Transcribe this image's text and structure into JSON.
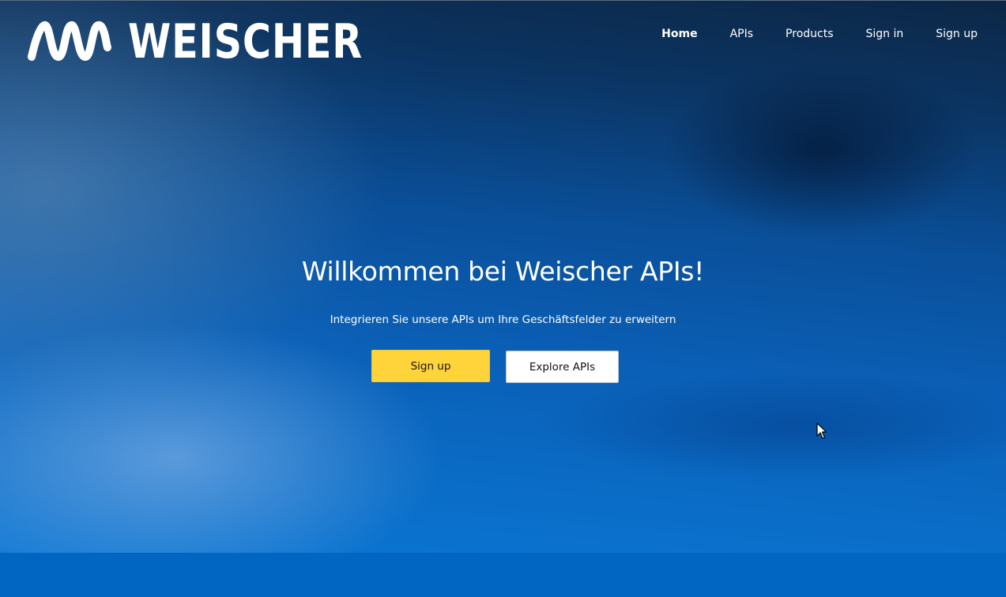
{
  "brand": {
    "name": "WEISCHER"
  },
  "nav": {
    "items": [
      {
        "label": "Home",
        "active": true
      },
      {
        "label": "APIs",
        "active": false
      },
      {
        "label": "Products",
        "active": false
      },
      {
        "label": "Sign in",
        "active": false
      },
      {
        "label": "Sign up",
        "active": false
      }
    ]
  },
  "hero": {
    "title": "Willkommen bei Weischer APIs!",
    "subtitle": "Integrieren Sie unsere APIs um Ihre Geschäftsfelder zu erweitern",
    "primary_button": "Sign up",
    "secondary_button": "Explore APIs"
  },
  "colors": {
    "accent": "#ffd43b",
    "background_blue": "#0a6ec8",
    "background_dark": "#0c2746",
    "text": "#ffffff"
  },
  "icons": {
    "logo_mark": "weischer-wave-logo-icon",
    "pointer": "mouse-cursor-icon"
  }
}
